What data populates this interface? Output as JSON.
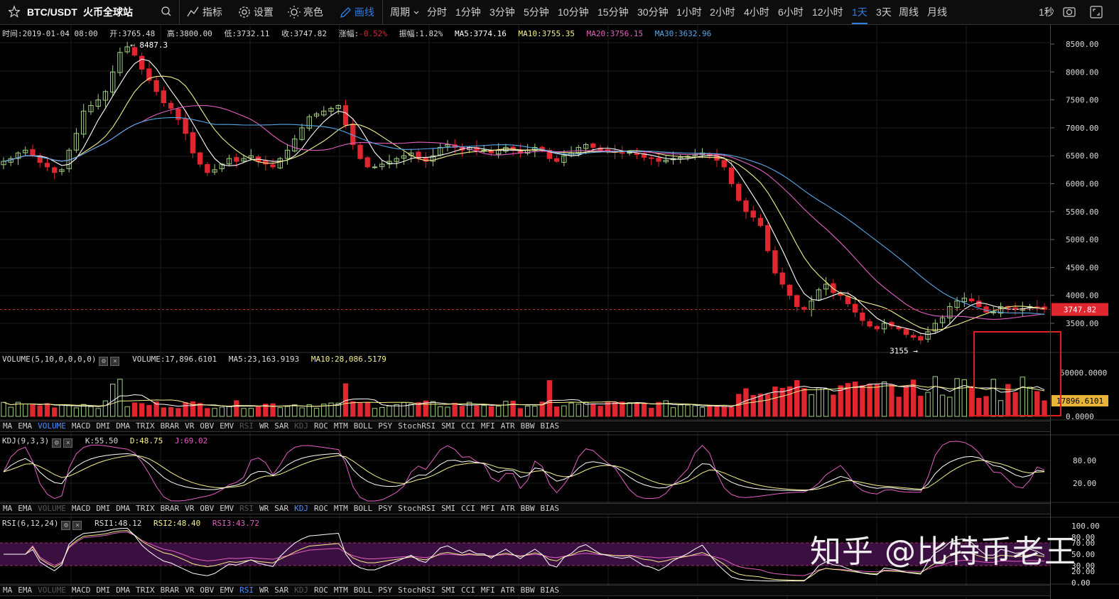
{
  "toolbar": {
    "symbol": "BTC/USDT",
    "exchange": "火币全球站",
    "indicators_label": "指标",
    "settings_label": "设置",
    "theme_label": "亮色",
    "draw_label": "画线",
    "period_label": "周期",
    "second_label": "1秒",
    "icons": [
      "star-icon",
      "search-icon",
      "indicator-icon",
      "gear-icon",
      "sun-icon",
      "pen-icon",
      "chevron-down-icon",
      "snapshot-icon",
      "fullscreen-icon"
    ]
  },
  "intervals": [
    {
      "label": "分时",
      "active": false
    },
    {
      "label": "1分钟",
      "active": false
    },
    {
      "label": "3分钟",
      "active": false
    },
    {
      "label": "5分钟",
      "active": false
    },
    {
      "label": "10分钟",
      "active": false
    },
    {
      "label": "15分钟",
      "active": false
    },
    {
      "label": "30分钟",
      "active": false
    },
    {
      "label": "1小时",
      "active": false
    },
    {
      "label": "2小时",
      "active": false
    },
    {
      "label": "4小时",
      "active": false
    },
    {
      "label": "6小时",
      "active": false
    },
    {
      "label": "12小时",
      "active": false
    },
    {
      "label": "1天",
      "active": true
    },
    {
      "label": "3天",
      "active": false
    },
    {
      "label": "周线",
      "active": false
    },
    {
      "label": "月线",
      "active": false
    }
  ],
  "info": {
    "time": "时间:2019-01-04 08:00",
    "open": "开:3765.48",
    "high": "高:3800.00",
    "low": "低:3732.11",
    "close": "收:3747.82",
    "change_label": "涨幅:",
    "change_value": "-0.52%",
    "amplitude": "振幅:1.82%",
    "ma5": "MA5:3774.16",
    "ma10": "MA10:3755.35",
    "ma20": "MA20:3756.15",
    "ma30": "MA30:3632.96"
  },
  "price_axis": {
    "ticks": [
      "8500.00",
      "8000.00",
      "7500.00",
      "7000.00",
      "6500.00",
      "6000.00",
      "5500.00",
      "5000.00",
      "4500.00",
      "4000.00",
      "3500.00"
    ],
    "current_price": "3747.82",
    "high_annotation": "← 8487.3",
    "low_annotation": "3155 →"
  },
  "volume": {
    "header": "VOLUME(5,10,0,0,0,0)",
    "value": "VOLUME:17,896.6101",
    "ma5": "MA5:23,163.9193",
    "ma10": "MA10:28,086.5179",
    "ticks": [
      "50000.0000",
      "0.0000"
    ],
    "current_tag": "17896.6101"
  },
  "kdj": {
    "header": "KDJ(9,3,3)",
    "k": "K:55.50",
    "d": "D:48.75",
    "j": "J:69.02",
    "ticks": [
      "80.00",
      "20.00"
    ]
  },
  "rsi": {
    "header": "RSI(6,12,24)",
    "rsi1": "RSI1:48.12",
    "rsi2": "RSI2:48.40",
    "rsi3": "RSI3:43.72",
    "ticks": [
      "100.00",
      "80.00",
      "70.00",
      "50.00",
      "30.00",
      "20.00",
      "0.00"
    ]
  },
  "indicator_tabs": [
    "MA",
    "EMA",
    "VOLUME",
    "MACD",
    "DMI",
    "DMA",
    "TRIX",
    "BRAR",
    "VR",
    "OBV",
    "EMV",
    "RSI",
    "WR",
    "SAR",
    "KDJ",
    "ROC",
    "MTM",
    "BOLL",
    "PSY",
    "StochRSI",
    "SMI",
    "CCI",
    "MFI",
    "ATR",
    "BBW",
    "BIAS"
  ],
  "tab_rows": [
    {
      "active": "VOLUME",
      "dim": [
        "RSI",
        "KDJ"
      ]
    },
    {
      "active": "KDJ",
      "dim": [
        "VOLUME",
        "RSI"
      ]
    },
    {
      "active": "RSI",
      "dim": [
        "VOLUME",
        "KDJ"
      ]
    }
  ],
  "watermark": "知乎 @比特币老王",
  "colors": {
    "up": "#9fcf7f",
    "down": "#e0262f",
    "ma5": "#ffffff",
    "ma10": "#f5f08a",
    "ma20": "#e45fc3",
    "ma30": "#56a8e8",
    "change_negative": "#e0262f",
    "active_tab": "#2f7fe8"
  },
  "chart_data": {
    "type": "candlestick",
    "period": "1天",
    "price_range": [
      3000,
      8700
    ],
    "closes": [
      6400,
      6450,
      6550,
      6600,
      6500,
      6380,
      6300,
      6200,
      6250,
      6600,
      6900,
      7300,
      7400,
      7500,
      7650,
      8000,
      8350,
      8450,
      8300,
      8050,
      7850,
      7650,
      7450,
      7350,
      7150,
      6900,
      6550,
      6350,
      6200,
      6250,
      6350,
      6450,
      6400,
      6450,
      6500,
      6400,
      6350,
      6300,
      6450,
      6600,
      6800,
      7000,
      7200,
      7250,
      7300,
      7350,
      7400,
      7050,
      6700,
      6450,
      6300,
      6300,
      6350,
      6400,
      6450,
      6500,
      6550,
      6450,
      6400,
      6500,
      6650,
      6700,
      6650,
      6600,
      6650,
      6600,
      6600,
      6550,
      6600,
      6650,
      6600,
      6550,
      6600,
      6650,
      6600,
      6450,
      6400,
      6500,
      6550,
      6650,
      6700,
      6650,
      6600,
      6580,
      6560,
      6550,
      6560,
      6520,
      6470,
      6450,
      6400,
      6420,
      6450,
      6470,
      6490,
      6520,
      6550,
      6500,
      6420,
      6300,
      6000,
      5700,
      5500,
      5400,
      5250,
      4800,
      4400,
      4200,
      4000,
      3800,
      3750,
      3900,
      4100,
      4200,
      4050,
      4000,
      3850,
      3700,
      3550,
      3450,
      3400,
      3500,
      3450,
      3400,
      3300,
      3250,
      3200,
      3350,
      3500,
      3600,
      3800,
      3900,
      3950,
      3900,
      3800,
      3700,
      3700,
      3800,
      3780,
      3750,
      3760,
      3800,
      3780,
      3747.82
    ],
    "volume_latest": 17896.6101,
    "kdj_latest": {
      "K": 55.5,
      "D": 48.75,
      "J": 69.02
    },
    "rsi_latest": {
      "RSI1": 48.12,
      "RSI2": 48.4,
      "RSI3": 43.72
    }
  }
}
